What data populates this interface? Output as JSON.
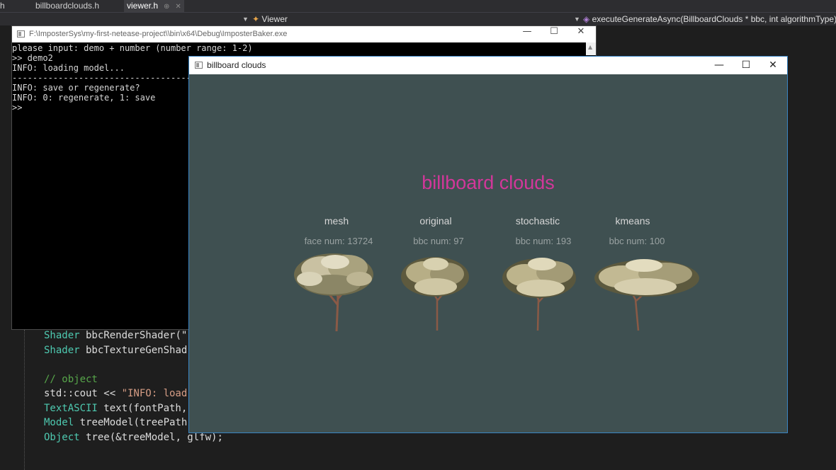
{
  "ide": {
    "tabs": [
      {
        "label": "h"
      },
      {
        "label": "billboardclouds.h"
      },
      {
        "label": "viewer.h",
        "active": true
      }
    ],
    "nav": {
      "class_label": "Viewer",
      "method_label": "executeGenerateAsync(BillboardClouds * bbc, int algorithmType)"
    },
    "code_lines": [
      {
        "type": "Shader",
        "rest": " bbcRenderShader(\""
      },
      {
        "type": "Shader",
        "rest": " bbcTextureGenShad"
      },
      {
        "comment": "// object"
      },
      {
        "plain": "std::cout << ",
        "str": "\"INFO: load"
      },
      {
        "type": "TextASCII",
        "rest": " text(fontPath,"
      },
      {
        "type": "Model",
        "rest": " treeModel(treePath"
      },
      {
        "type": "Object",
        "rest": " tree(&treeModel, glfw);"
      }
    ]
  },
  "console": {
    "title": "F:\\ImposterSys\\my-first-netease-project\\\\bin\\x64\\Debug\\ImposterBaker.exe",
    "lines": [
      "please input: demo + number (number range: 1-2)",
      ">> demo2",
      "INFO: loading model...",
      "-----------------------------------------------------------------------------------",
      "INFO: save or regenerate?",
      "INFO: 0: regenerate, 1: save",
      ">>"
    ]
  },
  "viewer": {
    "title": "billboard clouds",
    "heading": "billboard clouds",
    "accent_color": "#d2379a",
    "background_color": "#3f5051",
    "columns": [
      {
        "label": "mesh",
        "sub": "face num: 13724",
        "icon": "tree-mesh-render"
      },
      {
        "label": "original",
        "sub": "bbc num: 97",
        "icon": "tree-original-render"
      },
      {
        "label": "stochastic",
        "sub": "bbc num: 193",
        "icon": "tree-stochastic-render"
      },
      {
        "label": "kmeans",
        "sub": "bbc num: 100",
        "icon": "tree-kmeans-render"
      }
    ]
  },
  "window_controls": {
    "minimize": "—",
    "maximize": "☐",
    "close": "✕"
  }
}
